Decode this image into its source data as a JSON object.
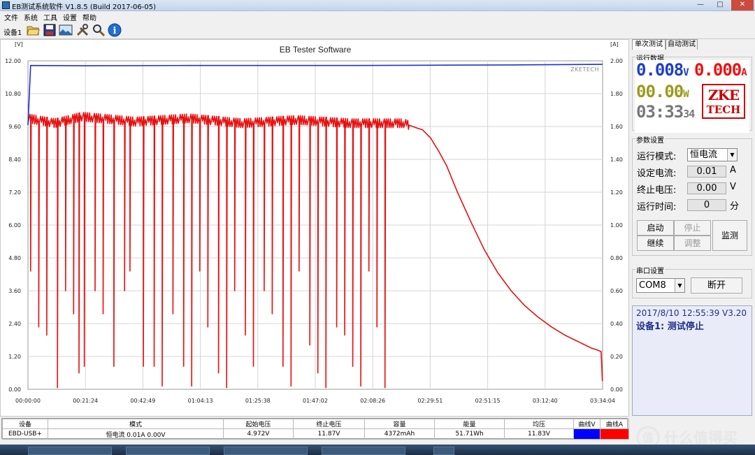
{
  "window": {
    "title": "EB测试系统软件 V1.8.5 (Build 2017-06-05)",
    "controls": [
      "—",
      "□",
      "✕"
    ]
  },
  "menu": [
    "文件",
    "系统",
    "工具",
    "设置",
    "帮助"
  ],
  "toolbar": {
    "device_label": "设备1",
    "buttons": [
      "folder-open",
      "save",
      "image",
      "tools",
      "search",
      "info"
    ]
  },
  "chart": {
    "title": "EB Tester Software",
    "watermark": "ZKETECH",
    "left_unit": "[V]",
    "right_unit": "[A]"
  },
  "chart_data": {
    "type": "line",
    "title": "EB Tester Software",
    "xlabel": "",
    "ylabel_left": "[V]",
    "ylabel_right": "[A]",
    "x_ticks": [
      "00:00:00",
      "00:21:24",
      "00:42:49",
      "01:04:13",
      "01:25:38",
      "01:47:02",
      "02:08:26",
      "02:29:51",
      "02:51:15",
      "03:12:40",
      "03:34:04"
    ],
    "y_left_ticks": [
      "0.00",
      "1.20",
      "2.40",
      "3.60",
      "4.80",
      "6.00",
      "7.20",
      "8.40",
      "9.60",
      "10.80",
      "12.00"
    ],
    "y_right_ticks": [
      "0.00",
      "0.20",
      "0.40",
      "0.60",
      "0.80",
      "1.00",
      "1.20",
      "1.40",
      "1.60",
      "1.80",
      "2.00"
    ],
    "ylim_left": [
      0,
      12
    ],
    "ylim_right": [
      0,
      2
    ],
    "grid": true,
    "series": [
      {
        "name": "曲线V",
        "axis": "left",
        "color": "#2030d0",
        "points": [
          [
            0,
            9.65
          ],
          [
            1,
            11.83
          ],
          [
            20,
            11.82
          ],
          [
            60,
            11.83
          ],
          [
            120,
            11.83
          ],
          [
            150,
            11.84
          ],
          [
            180,
            11.85
          ],
          [
            214,
            11.87
          ]
        ]
      },
      {
        "name": "曲线A",
        "axis": "right",
        "color": "#e81010",
        "points": [
          [
            0,
            1.65
          ],
          [
            10,
            1.62
          ],
          [
            20,
            1.66
          ],
          [
            40,
            1.63
          ],
          [
            60,
            1.65
          ],
          [
            80,
            1.62
          ],
          [
            100,
            1.64
          ],
          [
            120,
            1.62
          ],
          [
            140,
            1.62
          ],
          [
            145,
            1.59
          ],
          [
            147,
            1.58
          ],
          [
            150,
            1.53
          ],
          [
            153,
            1.45
          ],
          [
            156,
            1.36
          ],
          [
            160,
            1.2
          ],
          [
            165,
            1.02
          ],
          [
            170,
            0.85
          ],
          [
            175,
            0.71
          ],
          [
            180,
            0.6
          ],
          [
            185,
            0.51
          ],
          [
            190,
            0.44
          ],
          [
            195,
            0.38
          ],
          [
            200,
            0.33
          ],
          [
            205,
            0.29
          ],
          [
            210,
            0.25
          ],
          [
            212,
            0.24
          ],
          [
            213.5,
            0.23
          ],
          [
            214,
            0.05
          ]
        ]
      }
    ],
    "current_dropouts_min": [
      1,
      4,
      7,
      11,
      14,
      17,
      19,
      21,
      25,
      28,
      32,
      36,
      38,
      43,
      47,
      50,
      54,
      58,
      61,
      64,
      67,
      71,
      74,
      77,
      81,
      84,
      88,
      91,
      95,
      98,
      101,
      105,
      108,
      111,
      115,
      118,
      121,
      124,
      127,
      130,
      133
    ]
  },
  "panel": {
    "tabs": [
      "单次测试",
      "自动测试"
    ],
    "run_data_label": "运行数据",
    "voltage": "0.008",
    "voltage_unit": "V",
    "current": "0.000",
    "current_unit": "A",
    "power": "00.00",
    "power_unit": "W",
    "time_main": "03:33",
    "time_sec": "34",
    "logo_line1": "ZKE",
    "logo_line2": "TECH",
    "params_label": "参数设置",
    "mode_label": "运行模式:",
    "mode_value": "恒电流",
    "set_current_label": "设定电流:",
    "set_current_value": "0.01",
    "set_current_unit": "A",
    "cutoff_voltage_label": "终止电压:",
    "cutoff_voltage_value": "0.00",
    "cutoff_voltage_unit": "V",
    "run_time_label": "运行时间:",
    "run_time_value": "0",
    "run_time_unit": "分",
    "btn_start": "启动",
    "btn_stop": "停止",
    "btn_continue": "继续",
    "btn_adjust": "调整",
    "btn_monitor": "监测",
    "serial_label": "串口设置",
    "port_value": "COM8",
    "btn_disconnect": "断开",
    "status_line1": "2017/8/10 12:55:39  V3.20",
    "status_line2": "设备1: 测试停止"
  },
  "table": {
    "headers": [
      "设备",
      "模式",
      "起始电压",
      "终止电压",
      "容量",
      "能量",
      "均压",
      "曲线V",
      "曲线A"
    ],
    "row": [
      "EBD-USB+",
      "恒电流  0.01A  0.00V",
      "4.972V",
      "11.87V",
      "4372mAh",
      "51.71Wh",
      "11.83V",
      "",
      ""
    ],
    "swatch_v": "#0000ff",
    "swatch_a": "#ff0000"
  },
  "watermark_text": "什么值得买"
}
